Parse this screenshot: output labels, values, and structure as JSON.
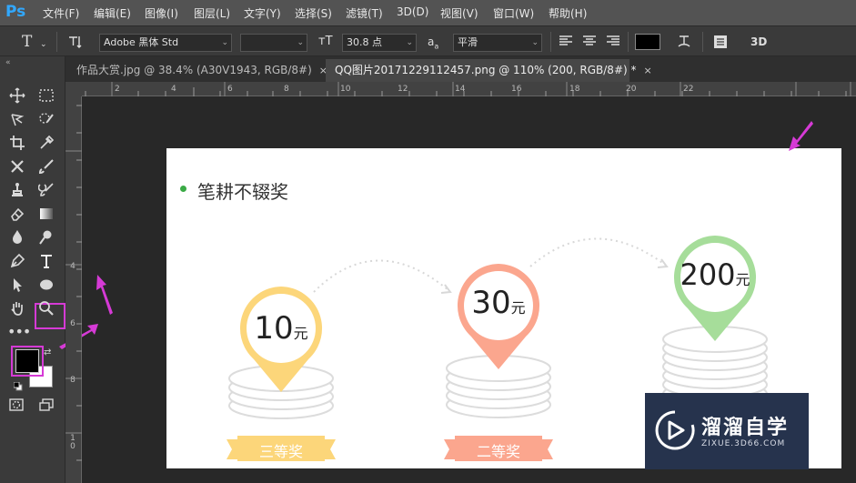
{
  "app": {
    "logo": "Ps"
  },
  "menu": [
    "文件(F)",
    "编辑(E)",
    "图像(I)",
    "图层(L)",
    "文字(Y)",
    "选择(S)",
    "滤镜(T)",
    "3D(D)",
    "视图(V)",
    "窗口(W)",
    "帮助(H)"
  ],
  "options": {
    "tool_icon": "T",
    "font_family": "Adobe 黑体 Std",
    "font_style": "",
    "font_size": "30.8 点",
    "aa_label": "a",
    "antialias": "平滑",
    "text_color": "#000000",
    "threed_label": "3D"
  },
  "tabs": [
    {
      "label": "作品大赏.jpg @ 38.4% (A30V1943, RGB/8#)",
      "close": "×"
    },
    {
      "label": "QQ图片20171229112457.png @ 110% (200, RGB/8#) *",
      "close": "×"
    }
  ],
  "ruler_top": [
    "2",
    "4",
    "6",
    "8",
    "10",
    "12",
    "14",
    "16",
    "18",
    "20",
    "22"
  ],
  "ruler_left": [
    "4",
    "6",
    "8",
    "1\n0"
  ],
  "canvas": {
    "title": "笔耕不辍奖",
    "prizes": [
      {
        "amount": "10",
        "unit": "元",
        "label": "三等奖",
        "color": "#fcd67a"
      },
      {
        "amount": "30",
        "unit": "元",
        "label": "二等奖",
        "color": "#fba68e"
      },
      {
        "amount": "200",
        "unit": "元",
        "label": "",
        "color": "#a6dd9a"
      }
    ]
  },
  "colors": {
    "foreground": "#000000",
    "background": "#ffffff",
    "highlight": "#d63ad6",
    "accent": "#31a8ff"
  },
  "watermark": {
    "title": "溜溜自学",
    "subtitle": "ZIXUE.3D66.COM"
  }
}
